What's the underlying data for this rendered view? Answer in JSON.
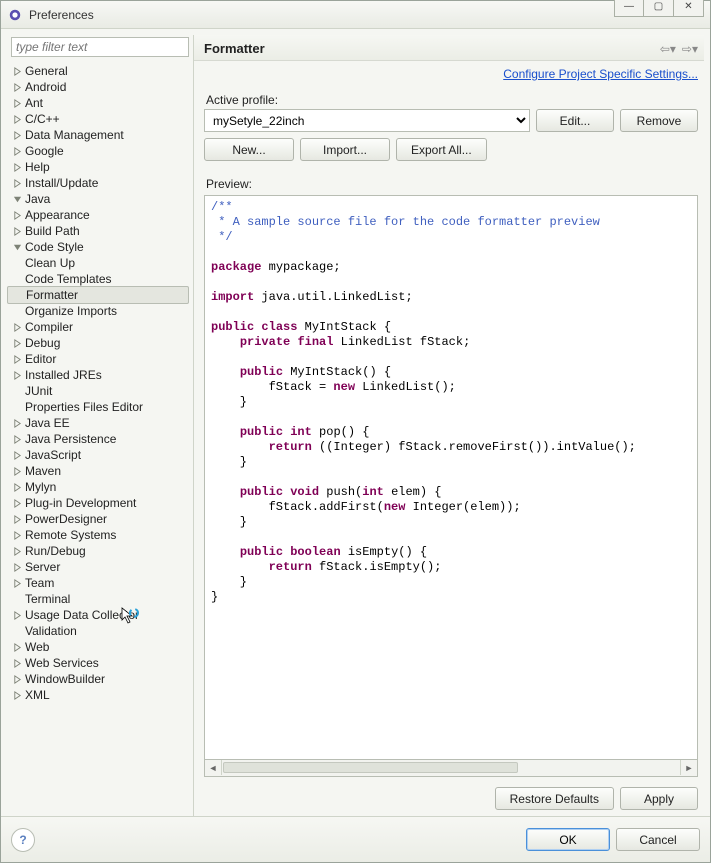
{
  "window": {
    "title": "Preferences"
  },
  "win_controls": {
    "min": "—",
    "max": "▢",
    "close": "✕"
  },
  "filter": {
    "placeholder": "type filter text"
  },
  "tree": {
    "general": "General",
    "android": "Android",
    "ant": "Ant",
    "cpp": "C/C++",
    "data_mgmt": "Data Management",
    "google": "Google",
    "help": "Help",
    "install_update": "Install/Update",
    "java": "Java",
    "java_children": {
      "appearance": "Appearance",
      "build_path": "Build Path",
      "code_style": "Code Style",
      "code_style_children": {
        "clean_up": "Clean Up",
        "code_templates": "Code Templates",
        "formatter": "Formatter",
        "organize_imports": "Organize Imports"
      },
      "compiler": "Compiler",
      "debug": "Debug",
      "editor": "Editor",
      "installed_jres": "Installed JREs",
      "junit": "JUnit",
      "pfiles_editor": "Properties Files Editor"
    },
    "java_ee": "Java EE",
    "java_persist": "Java Persistence",
    "javascript": "JavaScript",
    "maven": "Maven",
    "mylyn": "Mylyn",
    "plugin_dev": "Plug-in Development",
    "power_designer": "PowerDesigner",
    "remote_systems": "Remote Systems",
    "run_debug": "Run/Debug",
    "server": "Server",
    "team": "Team",
    "terminal": "Terminal",
    "usage_data": "Usage Data Collector",
    "validation": "Validation",
    "web": "Web",
    "web_services": "Web Services",
    "window_builder": "WindowBuilder",
    "xml": "XML"
  },
  "header": {
    "title": "Formatter"
  },
  "link": {
    "configure": "Configure Project Specific Settings..."
  },
  "profile": {
    "label": "Active profile:",
    "selected": "mySetyle_22inch"
  },
  "buttons": {
    "edit": "Edit...",
    "remove": "Remove",
    "new": "New...",
    "import": "Import...",
    "export_all": "Export All...",
    "restore_defaults": "Restore Defaults",
    "apply": "Apply",
    "ok": "OK",
    "cancel": "Cancel"
  },
  "preview": {
    "label": "Preview:",
    "l1": "/**",
    "l2": " * A sample source file for the code formatter preview",
    "l3": " */",
    "kw_package": "package",
    "pkg_name": " mypackage;",
    "kw_import": "import",
    "import_name": " java.util.LinkedList;",
    "kw_public": "public",
    "kw_class": "class",
    "class_name": " MyIntStack {",
    "kw_private": "private",
    "kw_final": "final",
    "field_decl": " LinkedList fStack;",
    "ctor_sig": " MyIntStack() {",
    "ctor_body1": "        fStack = ",
    "kw_new1": "new",
    "ctor_body2": " LinkedList();",
    "close_brace": "    }",
    "kw_int": "int",
    "pop_sig": " pop() {",
    "kw_return1": "return",
    "pop_body": " ((Integer) fStack.removeFirst()).intValue();",
    "kw_void": "void",
    "push_sig": " push(",
    "push_arg": " elem) {",
    "push_body1": "        fStack.addFirst(",
    "kw_new2": "new",
    "push_body2": " Integer(elem));",
    "kw_boolean": "boolean",
    "isempty_sig": " isEmpty() {",
    "kw_return2": "return",
    "isempty_body": " fStack.isEmpty();",
    "class_close": "}"
  }
}
